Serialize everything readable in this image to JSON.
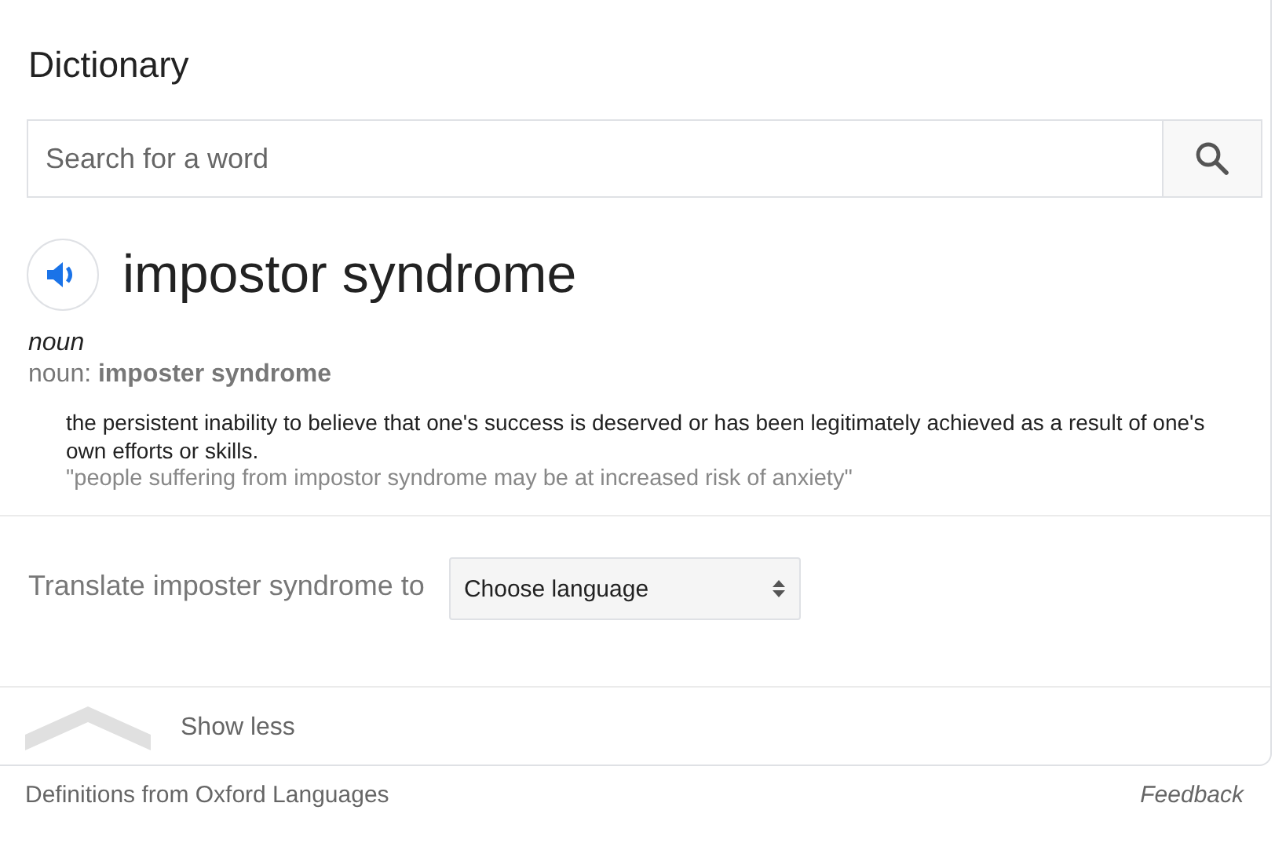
{
  "title": "Dictionary",
  "search": {
    "placeholder": "Search for a word"
  },
  "entry": {
    "word": "impostor syndrome",
    "part_of_speech": "noun",
    "variant_label": "noun:",
    "variant": "imposter syndrome",
    "definition": "the persistent inability to believe that one's success is deserved or has been legitimately achieved as a result of one's own efforts or skills.",
    "example": "\"people suffering from impostor syndrome may be at increased risk of anxiety\""
  },
  "translate": {
    "label": "Translate imposter syndrome to",
    "select": "Choose language"
  },
  "toggle": {
    "label": "Show less"
  },
  "footer": {
    "source": "Definitions from Oxford Languages",
    "feedback": "Feedback"
  }
}
